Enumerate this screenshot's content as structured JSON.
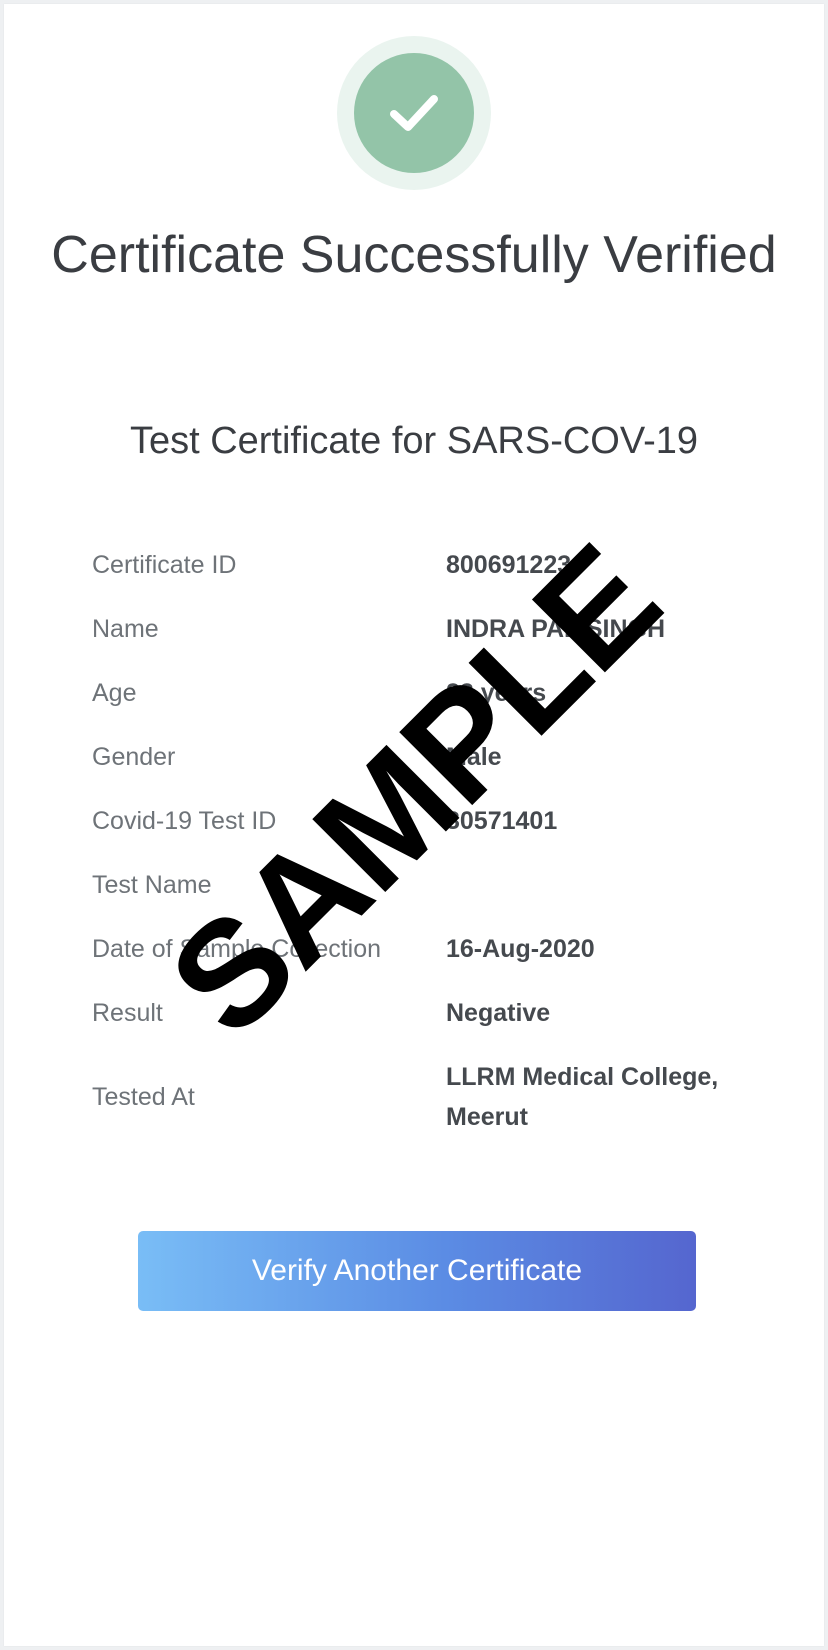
{
  "header": {
    "title": "Certificate Successfully Verified",
    "subtitle": "Test Certificate for SARS-COV-19"
  },
  "icons": {
    "check": "check-icon",
    "accent": "#93c4a8"
  },
  "details": [
    {
      "label": "Certificate ID",
      "value": "800691223"
    },
    {
      "label": "Name",
      "value": "INDRA PAL SINGH"
    },
    {
      "label": "Age",
      "value": "23 years"
    },
    {
      "label": "Gender",
      "value": "Male"
    },
    {
      "label": "Covid-19 Test ID",
      "value": "30571401"
    },
    {
      "label": "Test Name",
      "value": ""
    },
    {
      "label": "Date of Sample Collection",
      "value": "16-Aug-2020"
    },
    {
      "label": "Result",
      "value": "Negative"
    },
    {
      "label": "Tested At",
      "value": "LLRM Medical College, Meerut"
    }
  ],
  "actions": {
    "verify_another_label": "Verify Another Certificate"
  },
  "watermark": {
    "text": "SAMPLE"
  },
  "colors": {
    "button_start": "#79bdf6",
    "button_end": "#5566cf",
    "text_primary": "#3a3d42",
    "text_label": "#6e7378"
  }
}
